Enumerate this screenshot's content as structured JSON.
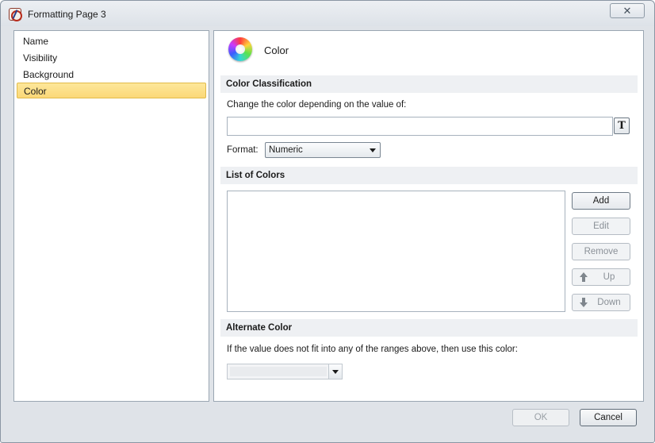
{
  "window": {
    "title": "Formatting Page 3",
    "close_label": "✕"
  },
  "sidebar": {
    "items": [
      {
        "label": "Name",
        "selected": false
      },
      {
        "label": "Visibility",
        "selected": false
      },
      {
        "label": "Background",
        "selected": false
      },
      {
        "label": "Color",
        "selected": true
      }
    ]
  },
  "panel": {
    "title": "Color",
    "icon": "color-wheel-icon",
    "classification": {
      "header": "Color Classification",
      "prompt": "Change the color depending on the value of:",
      "value_field": "",
      "insert_text_label": "T",
      "format_label": "Format:",
      "format_value": "Numeric"
    },
    "colors": {
      "header": "List of Colors",
      "items": [],
      "buttons": {
        "add": "Add",
        "edit": "Edit",
        "remove": "Remove",
        "up": "Up",
        "down": "Down"
      }
    },
    "alternate": {
      "header": "Alternate Color",
      "prompt": "If the value does not fit into any of the ranges above, then use this color:",
      "value": ""
    }
  },
  "footer": {
    "ok_label": "OK",
    "cancel_label": "Cancel"
  },
  "colors": {
    "selection": "#fbd878",
    "section_bg": "#eef0f3"
  }
}
